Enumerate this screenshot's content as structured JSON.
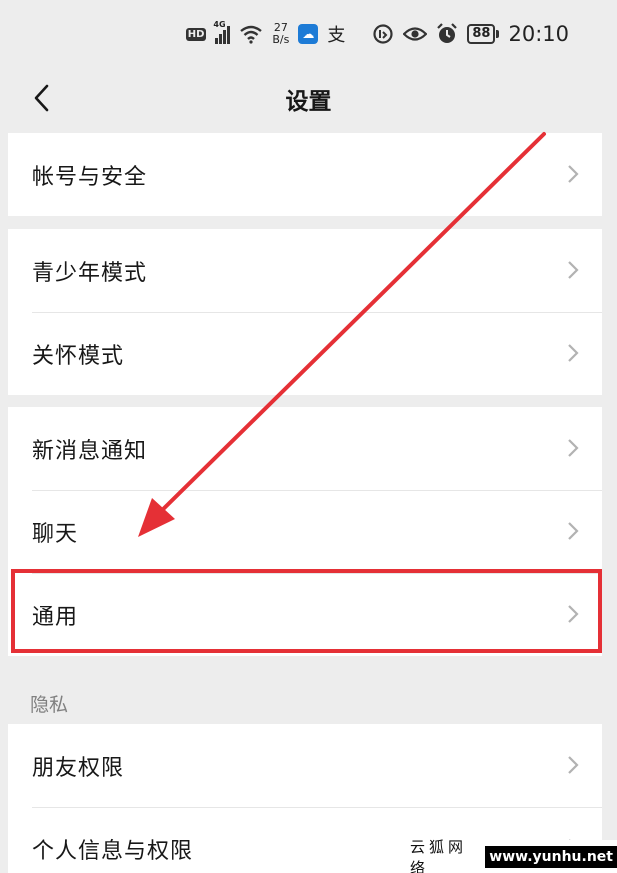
{
  "status_bar": {
    "hd": "HD",
    "network": "4G",
    "speed_value": "27",
    "speed_unit": "B/s",
    "app_icon_glyph": "☁",
    "alipay_glyph": "支",
    "battery": "88",
    "time": "20:10"
  },
  "header": {
    "title": "设置",
    "back_icon": "chevron-left-icon"
  },
  "groups": [
    {
      "items": [
        {
          "label": "帐号与安全"
        }
      ]
    },
    {
      "items": [
        {
          "label": "青少年模式"
        },
        {
          "label": "关怀模式"
        }
      ]
    },
    {
      "items": [
        {
          "label": "新消息通知"
        },
        {
          "label": "聊天"
        },
        {
          "label": "通用"
        }
      ]
    },
    {
      "items": [
        {
          "label": "朋友权限"
        },
        {
          "label": "个人信息与权限"
        }
      ]
    }
  ],
  "section_privacy": "隐私",
  "annotation": {
    "highlight_color": "#e53036",
    "arrow_color": "#e53036"
  },
  "watermark": {
    "text": "云狐网络",
    "url": "www.yunhu.net"
  },
  "colors": {
    "background": "#ededed",
    "card": "#ffffff",
    "text": "#181818",
    "secondary_text": "#808080",
    "chevron": "#b2b2b2"
  }
}
